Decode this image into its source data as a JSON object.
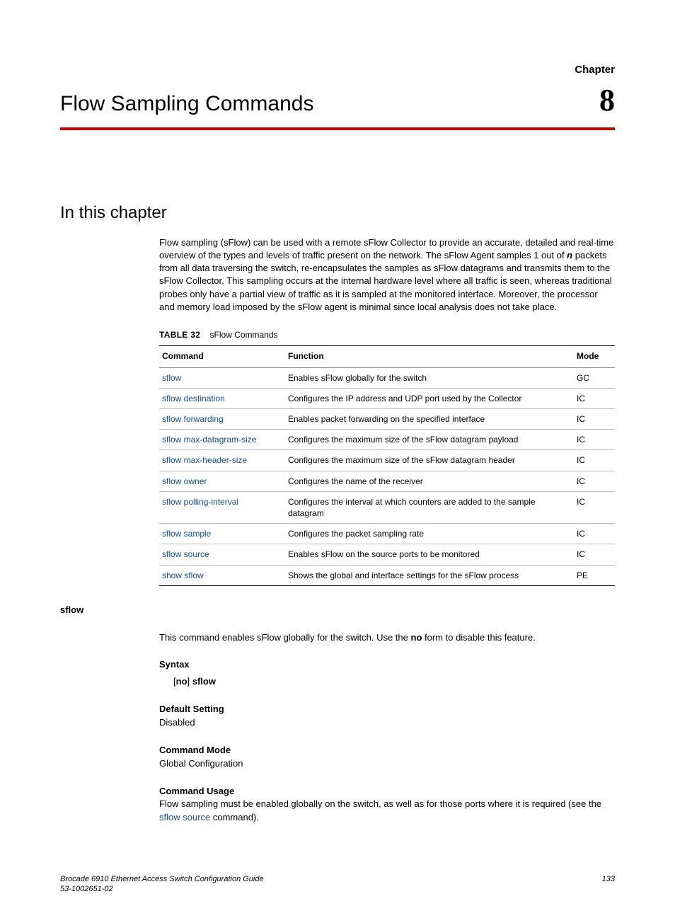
{
  "header": {
    "chapter_label": "Chapter",
    "chapter_number": "8",
    "chapter_title": "Flow Sampling Commands"
  },
  "section": {
    "title": "In this chapter",
    "intro_pre": "Flow sampling (sFlow) can be used with a remote sFlow Collector to provide an accurate, detailed and real-time overview of the types and levels of traffic present on the network. The sFlow Agent samples 1 out of ",
    "intro_n": "n",
    "intro_post": " packets from all data traversing the switch, re-encapsulates the samples as sFlow datagrams and transmits them to the sFlow Collector. This sampling occurs at the internal hardware level where all traffic is seen, whereas traditional probes only have a partial view of traffic as it is sampled at the monitored interface. Moreover, the processor and memory load imposed by the sFlow agent is minimal since local analysis does not take place."
  },
  "table": {
    "label_prefix": "TABLE 32",
    "caption": "sFlow Commands",
    "headers": {
      "command": "Command",
      "function": "Function",
      "mode": "Mode"
    },
    "rows": [
      {
        "command": "sflow",
        "function": "Enables sFlow globally for the switch",
        "mode": "GC"
      },
      {
        "command": "sflow destination",
        "function": "Configures the IP address and UDP port used by the Collector",
        "mode": "IC"
      },
      {
        "command": "sflow forwarding",
        "function": "Enables packet forwarding on the specified interface",
        "mode": "IC"
      },
      {
        "command": "sflow max-datagram-size",
        "function": "Configures the maximum size of the sFlow datagram payload",
        "mode": "IC"
      },
      {
        "command": "sflow max-header-size",
        "function": "Configures the maximum size of the sFlow datagram header",
        "mode": "IC"
      },
      {
        "command": "sflow owner",
        "function": "Configures the name of the receiver",
        "mode": "IC"
      },
      {
        "command": "sflow polling-interval",
        "function": "Configures the interval at which counters are added to the sample datagram",
        "mode": "IC"
      },
      {
        "command": "sflow sample",
        "function": "Configures the packet sampling rate",
        "mode": "IC"
      },
      {
        "command": "sflow source",
        "function": "Enables sFlow on the source ports to be monitored",
        "mode": "IC"
      },
      {
        "command": "show sflow",
        "function": "Shows the global and interface settings for the sFlow process",
        "mode": "PE"
      }
    ]
  },
  "command_detail": {
    "name": "sflow",
    "description_pre": "This command enables sFlow globally for the switch. Use the ",
    "description_bold": "no",
    "description_post": " form to disable this feature.",
    "syntax_label": "Syntax",
    "syntax_lbracket": "[",
    "syntax_no": "no",
    "syntax_rbracket": "] ",
    "syntax_cmd": "sflow",
    "default_label": "Default Setting",
    "default_value": "Disabled",
    "mode_label": "Command Mode",
    "mode_value": "Global Configuration",
    "usage_label": "Command Usage",
    "usage_pre": "Flow sampling must be enabled globally on the switch, as well as for those ports where it is required (see the ",
    "usage_link": "sflow source",
    "usage_post": " command)."
  },
  "footer": {
    "line1": "Brocade 6910 Ethernet Access Switch Configuration Guide",
    "line2": "53-1002651-02",
    "page": "133"
  }
}
